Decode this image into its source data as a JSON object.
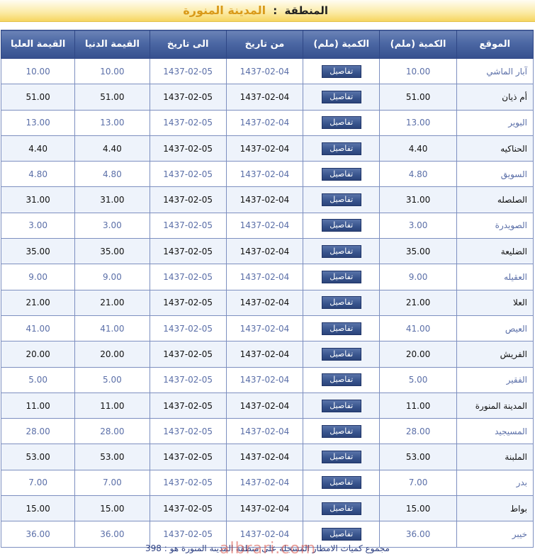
{
  "region": {
    "label": "المنطقة",
    "separator": ":",
    "value": "المدينة المنورة"
  },
  "table": {
    "headers": {
      "location": "الموقع",
      "quantity": "الكمية (ملم)",
      "details": "الكمية (ملم)",
      "from_date": "من تاريخ",
      "to_date": "الى تاريخ",
      "min": "القيمة الدنيا",
      "max": "القيمة العليا"
    },
    "details_label": "تفاصيل",
    "rows": [
      {
        "location": "آبار الماشي",
        "quantity": "10.00",
        "from": "1437-02-04",
        "to": "1437-02-05",
        "min": "10.00",
        "max": "10.00"
      },
      {
        "location": "أم ذيان",
        "quantity": "51.00",
        "from": "1437-02-04",
        "to": "1437-02-05",
        "min": "51.00",
        "max": "51.00"
      },
      {
        "location": "البوير",
        "quantity": "13.00",
        "from": "1437-02-04",
        "to": "1437-02-05",
        "min": "13.00",
        "max": "13.00"
      },
      {
        "location": "الحناكيه",
        "quantity": "4.40",
        "from": "1437-02-04",
        "to": "1437-02-05",
        "min": "4.40",
        "max": "4.40"
      },
      {
        "location": "السويق",
        "quantity": "4.80",
        "from": "1437-02-04",
        "to": "1437-02-05",
        "min": "4.80",
        "max": "4.80"
      },
      {
        "location": "الصلصله",
        "quantity": "31.00",
        "from": "1437-02-04",
        "to": "1437-02-05",
        "min": "31.00",
        "max": "31.00"
      },
      {
        "location": "الصويدرة",
        "quantity": "3.00",
        "from": "1437-02-04",
        "to": "1437-02-05",
        "min": "3.00",
        "max": "3.00"
      },
      {
        "location": "الضليعة",
        "quantity": "35.00",
        "from": "1437-02-04",
        "to": "1437-02-05",
        "min": "35.00",
        "max": "35.00"
      },
      {
        "location": "العقيله",
        "quantity": "9.00",
        "from": "1437-02-04",
        "to": "1437-02-05",
        "min": "9.00",
        "max": "9.00"
      },
      {
        "location": "العلا",
        "quantity": "21.00",
        "from": "1437-02-04",
        "to": "1437-02-05",
        "min": "21.00",
        "max": "21.00"
      },
      {
        "location": "العيص",
        "quantity": "41.00",
        "from": "1437-02-04",
        "to": "1437-02-05",
        "min": "41.00",
        "max": "41.00"
      },
      {
        "location": "الفريش",
        "quantity": "20.00",
        "from": "1437-02-04",
        "to": "1437-02-05",
        "min": "20.00",
        "max": "20.00"
      },
      {
        "location": "الفقير",
        "quantity": "5.00",
        "from": "1437-02-04",
        "to": "1437-02-05",
        "min": "5.00",
        "max": "5.00"
      },
      {
        "location": "المدينة المنورة",
        "quantity": "11.00",
        "from": "1437-02-04",
        "to": "1437-02-05",
        "min": "11.00",
        "max": "11.00"
      },
      {
        "location": "المسيجيد",
        "quantity": "28.00",
        "from": "1437-02-04",
        "to": "1437-02-05",
        "min": "28.00",
        "max": "28.00"
      },
      {
        "location": "الملبنة",
        "quantity": "53.00",
        "from": "1437-02-04",
        "to": "1437-02-05",
        "min": "53.00",
        "max": "53.00"
      },
      {
        "location": "بدر",
        "quantity": "7.00",
        "from": "1437-02-04",
        "to": "1437-02-05",
        "min": "7.00",
        "max": "7.00"
      },
      {
        "location": "بواط",
        "quantity": "15.00",
        "from": "1437-02-04",
        "to": "1437-02-05",
        "min": "15.00",
        "max": "15.00"
      },
      {
        "location": "خيبر",
        "quantity": "36.00",
        "from": "1437-02-04",
        "to": "1437-02-05",
        "min": "36.00",
        "max": "36.00"
      }
    ]
  },
  "summary": "مجموع كميات الامطار المسجلة على منطقة المدينة المنورة هو : 398",
  "watermark": "albrari.com",
  "colors": {
    "header_bg": "#4b67a3",
    "header_bar": "#f6d560",
    "region_value": "#d99a1a",
    "odd_row_text": "#5b6fa8",
    "even_row_bg": "#eef3fb"
  }
}
